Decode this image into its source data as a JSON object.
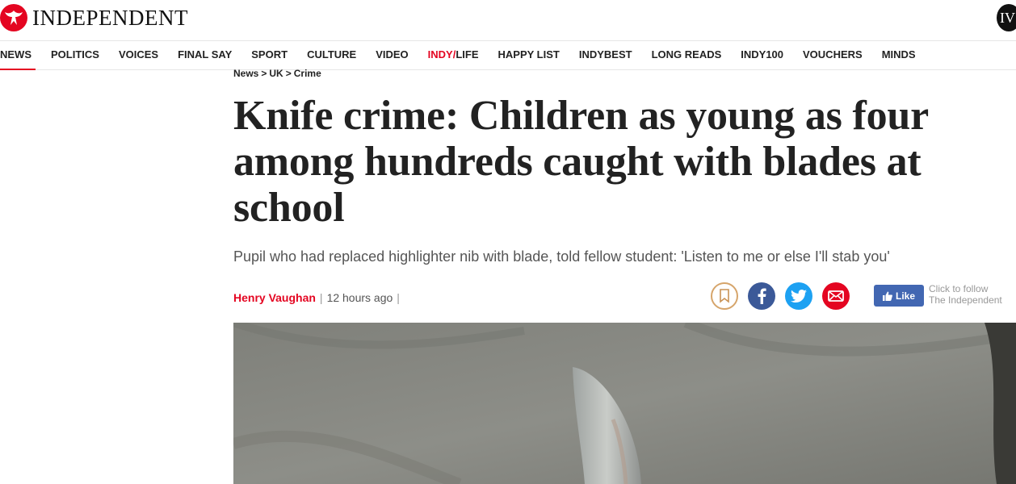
{
  "header": {
    "logo_text": "INDEPENDENT",
    "badge": "IV",
    "brand_color": "#e40521"
  },
  "nav": {
    "items": [
      {
        "label": "NEWS"
      },
      {
        "label": "POLITICS"
      },
      {
        "label": "VOICES"
      },
      {
        "label": "FINAL SAY"
      },
      {
        "label": "SPORT"
      },
      {
        "label": "CULTURE"
      },
      {
        "label": "VIDEO"
      },
      {
        "label_red": "INDY/",
        "label": "LIFE"
      },
      {
        "label": "HAPPY LIST"
      },
      {
        "label": "INDYBEST"
      },
      {
        "label": "LONG READS"
      },
      {
        "label": "INDY100"
      },
      {
        "label": "VOUCHERS"
      },
      {
        "label": "MINDS"
      }
    ],
    "active": "NEWS"
  },
  "breadcrumb": {
    "items": [
      "News",
      "UK",
      "Crime"
    ],
    "separator": ">"
  },
  "article": {
    "headline": "Knife crime: Children as young as four among hundreds caught with blades at school",
    "standfirst": "Pupil who had replaced highlighter nib with blade, told fellow student: 'Listen to me or else I'll stab you'",
    "author": "Henry Vaughan",
    "time": "12 hours ago",
    "byline_sep": "|"
  },
  "share": {
    "buttons": [
      "bookmark-icon",
      "facebook-icon",
      "twitter-icon",
      "email-icon"
    ],
    "like_label": "Like",
    "follow_line1": "Click to follow",
    "follow_line2": "The Independent"
  },
  "colors": {
    "accent": "#e40521",
    "facebook": "#3b5998",
    "twitter": "#1da1f2",
    "like": "#4267b2"
  }
}
